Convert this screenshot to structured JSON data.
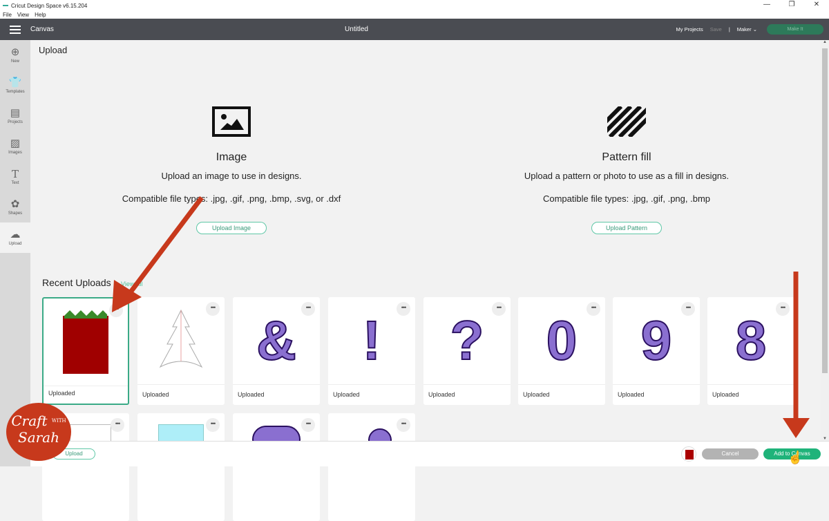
{
  "window": {
    "title": "Cricut Design Space  v6.15.204",
    "controls": [
      "—",
      "❐",
      "✕"
    ],
    "menu": [
      "File",
      "View",
      "Help"
    ]
  },
  "appbar": {
    "section": "Canvas",
    "doc_title": "Untitled",
    "my_projects": "My Projects",
    "save": "Save",
    "divider": "|",
    "machine": "Maker",
    "make_it": "Make It"
  },
  "sidebar": {
    "items": [
      {
        "label": "New",
        "icon": "plus-circle-icon"
      },
      {
        "label": "Templates",
        "icon": "tshirt-icon"
      },
      {
        "label": "Projects",
        "icon": "notebook-icon"
      },
      {
        "label": "Images",
        "icon": "image-icon"
      },
      {
        "label": "Text",
        "icon": "text-t-icon"
      },
      {
        "label": "Shapes",
        "icon": "shapes-icon"
      },
      {
        "label": "Upload",
        "icon": "cloud-upload-icon",
        "active": true
      }
    ]
  },
  "main": {
    "title": "Upload",
    "image_panel": {
      "heading": "Image",
      "description": "Upload an image to use in designs.",
      "types": "Compatible file types: .jpg, .gif, .png, .bmp, .svg, or .dxf",
      "button": "Upload Image"
    },
    "pattern_panel": {
      "heading": "Pattern fill",
      "description": "Upload a pattern or photo to use as a fill in designs.",
      "types": "Compatible file types: .jpg, .gif, .png, .bmp",
      "button": "Upload Pattern"
    },
    "recent": {
      "heading": "Recent Uploads",
      "view_all": "View All",
      "items": [
        {
          "label": "Uploaded",
          "thumb": "red-tree-strip",
          "selected": true
        },
        {
          "label": "Uploaded",
          "thumb": "outline-tree"
        },
        {
          "label": "Uploaded",
          "thumb": "baby-ampersand"
        },
        {
          "label": "Uploaded",
          "thumb": "baby-exclamation"
        },
        {
          "label": "Uploaded",
          "thumb": "baby-question"
        },
        {
          "label": "Uploaded",
          "thumb": "baby-zero"
        },
        {
          "label": "Uploaded",
          "thumb": "baby-nine"
        },
        {
          "label": "Uploaded",
          "thumb": "baby-eight"
        },
        {
          "label": "",
          "thumb": "blank-rect"
        },
        {
          "label": "",
          "thumb": "blue-rect"
        },
        {
          "label": "",
          "thumb": "baby-letter"
        },
        {
          "label": "",
          "thumb": "baby-letter-2"
        }
      ],
      "more_label": "•••"
    }
  },
  "footer": {
    "upload": "Upload",
    "cancel": "Cancel",
    "add_to_canvas": "Add to Canvas"
  },
  "watermark": {
    "line1": "Craft",
    "with": "WITH",
    "line2": "Sarah"
  },
  "colors": {
    "accent": "#1fb37a",
    "appbar": "#4a4c52",
    "annotation_arrow": "#c7391c"
  }
}
